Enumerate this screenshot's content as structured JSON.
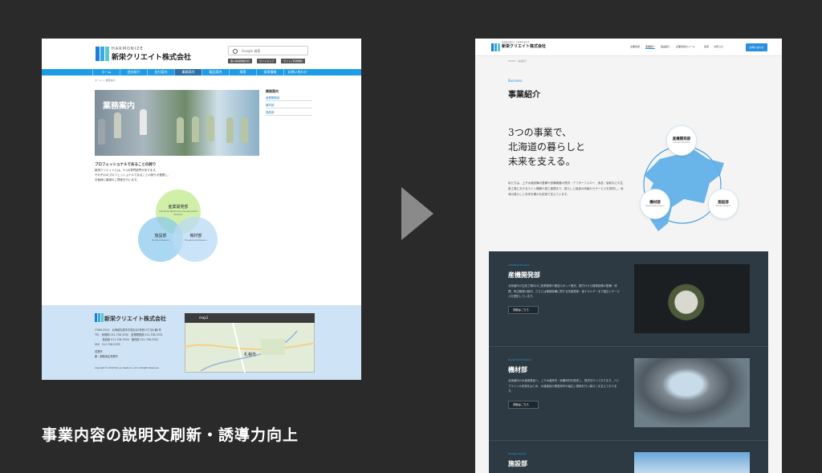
{
  "caption": "事業内容の説明文刷新・誘導力向上",
  "before": {
    "brand_small": "HARMONIZE",
    "brand": "新栄クリエイト株式会社",
    "search_placeholder": "Google 検索",
    "sub_buttons": [
      "個人情報保護方針",
      "サイトマップ",
      "サイトご利用規約"
    ],
    "nav": [
      "ホーム",
      "会社紹介",
      "会社案内",
      "業務案内",
      "製品案内",
      "採用",
      "採用情報",
      "お問い合わせ"
    ],
    "breadcrumb": "ホーム > 業務案内",
    "hero_title": "業務案内",
    "side_title": "業務案内",
    "side_items": [
      "産業開発部",
      "機材部",
      "施設部"
    ],
    "heading": "プロフェッショナルであることの誇り",
    "paragraphs": [
      "新栄クリエイトには、3つの専門部門があります。",
      "それぞれのプロフェッショナルであることの誇りが連携し、",
      "お客様に最適のご提案を行います。"
    ],
    "circles": [
      {
        "label": "産業開発部",
        "sub": "Industrial Machinery Development Division",
        "color": "#c9ec9a"
      },
      {
        "label": "施設部",
        "sub": "Facility Division",
        "color": "#8ec9ee"
      },
      {
        "label": "機材部",
        "sub": "Equipment Division",
        "color": "#b9d9f6"
      }
    ],
    "footer": {
      "brand": "新栄クリエイト株式会社",
      "address": "〒060-0012　北海道札幌市中央区北1条西13丁目4番1号",
      "lines": [
        "TEL　総務部 011-708-3330　産業開発部 011-708-3331",
        "　　　施設部 011-708-3334　機材部 011-708-3332",
        "FAX　011-708-3335"
      ],
      "branch_title": "営業所",
      "branch": "釧・釧路地区事業所",
      "copyright": "Copyright © 2019 Shin-ei Create Co.,Ltd. All Rights Reserved.",
      "map_title": "map1",
      "map_city": "札幌市"
    }
  },
  "after": {
    "brand_small": "北海道の暮らしと未来を支える",
    "brand": "新栄クリエイト株式会社",
    "nav": [
      "企業情報",
      "事業紹介",
      "製品紹介",
      "企業情報のメール",
      "採用",
      "お知らせ"
    ],
    "cta": "お問い合わせ",
    "breadcrumb": "HOME > 事業紹介",
    "section_en": "Business",
    "title": "事業紹介",
    "catch": [
      "3つの事業で、",
      "北海道の暮らしと",
      "未来を支える。"
    ],
    "body": "私たちは、上下水道設備の整備や設備機器の提供・アフターフォロー、食品・製紙などの生産工場におけるライン構築や施工管理まで、暮らしと製造の両面からサービスを提供し、地域の暮らしと未来を確かな技術で支えています。",
    "nodes": [
      {
        "label": "産機開発部",
        "sub": "Industrial Division"
      },
      {
        "label": "機材部",
        "sub": "Equipment Division"
      },
      {
        "label": "施設部",
        "sub": "Facility Division"
      }
    ],
    "divisions": [
      {
        "en": "Industrial Division",
        "name": "産機開発部",
        "desc": "北海道内の生産工場向けに産業機械や搬送ロボット販売、据付けから機械設備の整備・修理、特注機械の製作、さらには機械設備に関する改善提案・省エネルギーまで幅広いサービスを提供しています。",
        "button": "詳細はこちら"
      },
      {
        "en": "Equipment Division",
        "name": "機材部",
        "desc": "北海道内の水道事業者へ、上下水道資材・設備資材を販売し、提供を行っております。パイプラインの布設をはじめ、水道施設の関連資材の幅広い提案を行い暮らしを支えております。",
        "button": "詳細はこちら"
      },
      {
        "en": "Facility Division",
        "name": "施設部"
      }
    ]
  }
}
